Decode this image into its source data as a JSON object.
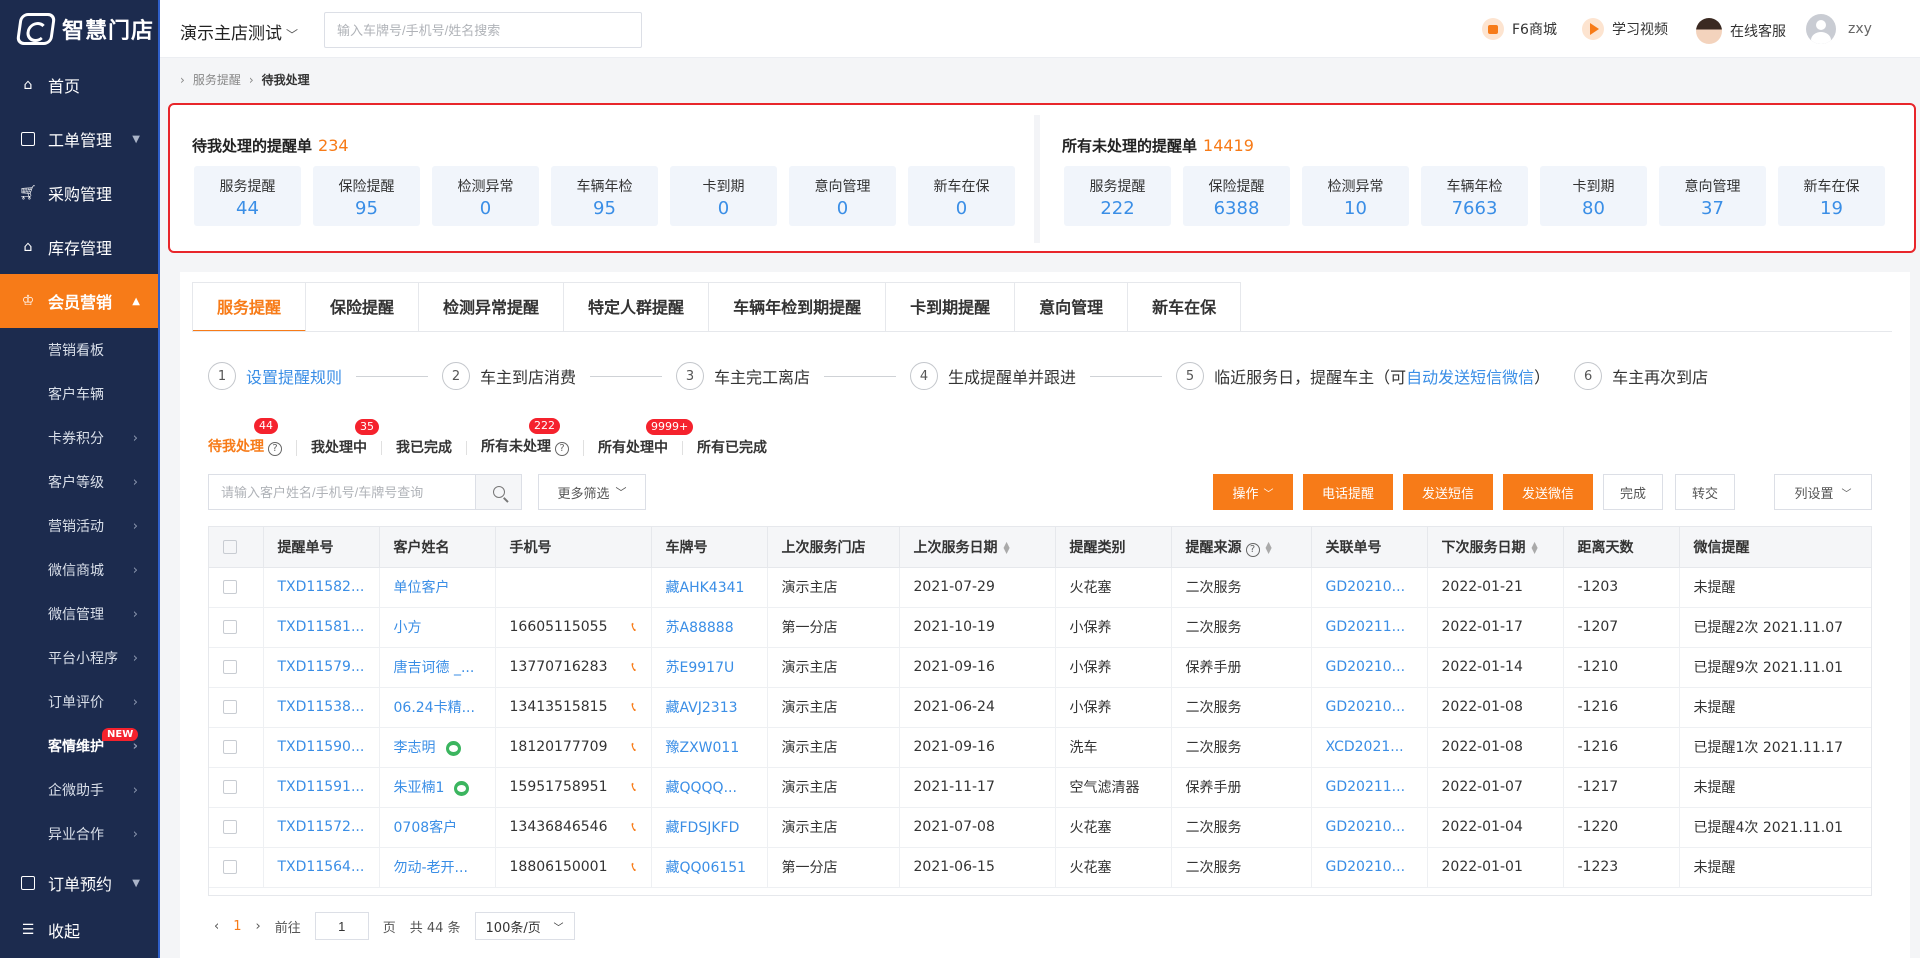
{
  "app": {
    "logo_text": "智慧门店"
  },
  "sidebar": {
    "items": [
      {
        "label": "首页"
      },
      {
        "label": "工单管理"
      },
      {
        "label": "采购管理"
      },
      {
        "label": "库存管理"
      },
      {
        "label": "会员营销"
      }
    ],
    "sub_items": [
      {
        "label": "营销看板"
      },
      {
        "label": "客户车辆"
      },
      {
        "label": "卡券积分"
      },
      {
        "label": "客户等级"
      },
      {
        "label": "营销活动"
      },
      {
        "label": "微信商城"
      },
      {
        "label": "微信管理"
      },
      {
        "label": "平台小程序"
      },
      {
        "label": "订单评价"
      },
      {
        "label": "客情维护",
        "badge": "NEW"
      },
      {
        "label": "企微助手"
      },
      {
        "label": "异业合作"
      }
    ],
    "bottom": [
      {
        "label": "订单预约"
      },
      {
        "label": "收起"
      }
    ]
  },
  "header": {
    "store_name": "演示主店测试",
    "search_placeholder": "输入车牌号/手机号/姓名搜索",
    "links": [
      "F6商城",
      "学习视频",
      "在线客服"
    ],
    "user": "zxy"
  },
  "breadcrumb": [
    "服务提醒",
    "待我处理"
  ],
  "summary": {
    "mine": {
      "title": "待我处理的提醒单",
      "total": "234",
      "cards": [
        {
          "label": "服务提醒",
          "value": "44"
        },
        {
          "label": "保险提醒",
          "value": "95"
        },
        {
          "label": "检测异常",
          "value": "0"
        },
        {
          "label": "车辆年检",
          "value": "95"
        },
        {
          "label": "卡到期",
          "value": "0"
        },
        {
          "label": "意向管理",
          "value": "0"
        },
        {
          "label": "新车在保",
          "value": "0"
        }
      ]
    },
    "all": {
      "title": "所有未处理的提醒单",
      "total": "14419",
      "cards": [
        {
          "label": "服务提醒",
          "value": "222"
        },
        {
          "label": "保险提醒",
          "value": "6388"
        },
        {
          "label": "检测异常",
          "value": "10"
        },
        {
          "label": "车辆年检",
          "value": "7663"
        },
        {
          "label": "卡到期",
          "value": "80"
        },
        {
          "label": "意向管理",
          "value": "37"
        },
        {
          "label": "新车在保",
          "value": "19"
        }
      ]
    }
  },
  "tabs": [
    "服务提醒",
    "保险提醒",
    "检测异常提醒",
    "特定人群提醒",
    "车辆年检到期提醒",
    "卡到期提醒",
    "意向管理",
    "新车在保"
  ],
  "steps": {
    "s1": "设置提醒规则",
    "s2": "车主到店消费",
    "s3": "车主完工离店",
    "s4": "生成提醒单并跟进",
    "s5_pre": "临近服务日，提醒车主（可",
    "s5_link": "自动发送短信微信",
    "s5_post": "）",
    "s6": "车主再次到店"
  },
  "status_tabs": [
    {
      "label": "待我处理",
      "badge": "44"
    },
    {
      "label": "我处理中",
      "badge": "35"
    },
    {
      "label": "我已完成",
      "badge": ""
    },
    {
      "label": "所有未处理",
      "badge": "222"
    },
    {
      "label": "所有处理中",
      "badge": "9999+"
    },
    {
      "label": "所有已完成",
      "badge": ""
    }
  ],
  "toolbar": {
    "search_placeholder": "请输入客户姓名/手机号/车牌号查询",
    "filter_label": "更多筛选",
    "buttons": [
      "操作",
      "电话提醒",
      "发送短信",
      "发送微信",
      "完成",
      "转交",
      "列设置"
    ]
  },
  "table": {
    "columns": [
      "提醒单号",
      "客户姓名",
      "手机号",
      "车牌号",
      "上次服务门店",
      "上次服务日期",
      "提醒类别",
      "提醒来源",
      "关联单号",
      "下次服务日期",
      "距离天数",
      "微信提醒"
    ],
    "rows": [
      [
        "TXD11582...",
        "单位客户",
        "",
        "藏AHK4341",
        "演示主店",
        "2021-07-29",
        "火花塞",
        "二次服务",
        "GD20210...",
        "2022-01-21",
        "-1203",
        "未提醒"
      ],
      [
        "TXD11581...",
        "小方",
        "16605115055",
        "苏A88888",
        "第一分店",
        "2021-10-19",
        "小保养",
        "二次服务",
        "GD20211...",
        "2022-01-17",
        "-1207",
        "已提醒2次 2021.11.07"
      ],
      [
        "TXD11579...",
        "唐吉诃德 _...",
        "13770716283",
        "苏E9917U",
        "演示主店",
        "2021-09-16",
        "小保养",
        "保养手册",
        "GD20210...",
        "2022-01-14",
        "-1210",
        "已提醒9次 2021.11.01"
      ],
      [
        "TXD11538...",
        "06.24卡精...",
        "13413515815",
        "藏AVJ2313",
        "演示主店",
        "2021-06-24",
        "小保养",
        "二次服务",
        "GD20210...",
        "2022-01-08",
        "-1216",
        "未提醒"
      ],
      [
        "TXD11590...",
        "李志明",
        "18120177709",
        "豫ZXW011",
        "演示主店",
        "2021-09-16",
        "洗车",
        "二次服务",
        "XCD2021...",
        "2022-01-08",
        "-1216",
        "已提醒1次 2021.11.17"
      ],
      [
        "TXD11591...",
        "朱亚楠1",
        "15951758951",
        "藏QQQQ...",
        "演示主店",
        "2021-11-17",
        "空气滤清器",
        "保养手册",
        "GD20211...",
        "2022-01-07",
        "-1217",
        "未提醒"
      ],
      [
        "TXD11572...",
        "0708客户",
        "13436846546",
        "藏FDSJKFD",
        "演示主店",
        "2021-07-08",
        "火花塞",
        "二次服务",
        "GD20210...",
        "2022-01-04",
        "-1220",
        "已提醒4次 2021.11.01"
      ],
      [
        "TXD11564...",
        "勿动-老开...",
        "18806150001",
        "藏QQ06151",
        "第一分店",
        "2021-06-15",
        "火花塞",
        "二次服务",
        "GD20210...",
        "2022-01-01",
        "-1223",
        "未提醒"
      ]
    ]
  },
  "pagination": {
    "current": "1",
    "goto_label": "前往",
    "goto_value": "1",
    "page_label": "页",
    "total": "共 44 条",
    "page_size": "100条/页"
  },
  "colors": {
    "accent": "#f77b18",
    "sidebar": "#1c2b4e",
    "link": "#3a8ee6",
    "badge": "#f5222d"
  }
}
